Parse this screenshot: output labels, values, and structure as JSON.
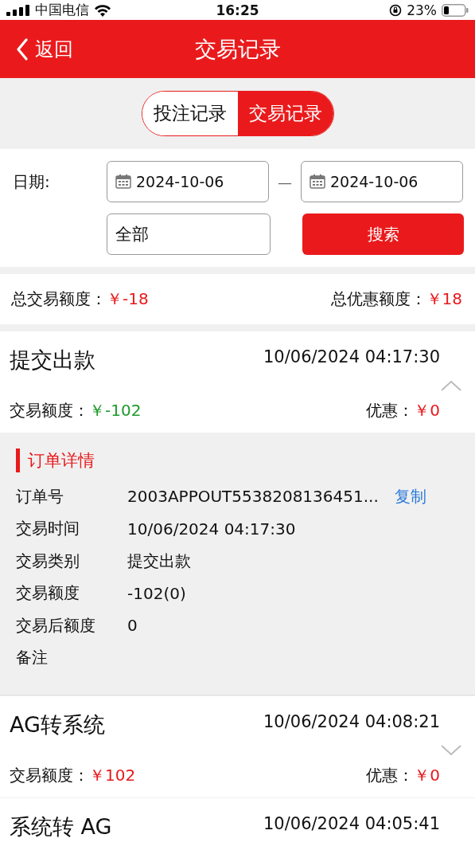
{
  "status_bar": {
    "carrier": "中国电信",
    "time": "16:25",
    "battery": "23%"
  },
  "header": {
    "back": "返回",
    "title": "交易记录"
  },
  "tabs": [
    {
      "label": "投注记录",
      "selected": false
    },
    {
      "label": "交易记录",
      "selected": true
    }
  ],
  "filter": {
    "date_label": "日期:",
    "start_date": "2024-10-06",
    "separator": "—",
    "end_date": "2024-10-06",
    "type": "全部",
    "search_button": "搜索"
  },
  "totals": {
    "transaction_label": "总交易额度：",
    "transaction_value": "￥-18",
    "bonus_label": "总优惠额度：",
    "bonus_value": "￥18"
  },
  "records": [
    {
      "title": "提交出款",
      "time": "10/06/2024 04:17:30",
      "amount_label": "交易额度：",
      "amount": "￥-102",
      "color": "#1e9a2a",
      "bonus_label": "优惠：",
      "bonus": "￥0",
      "expanded": true,
      "details": {
        "heading": "订单详情",
        "rows": [
          {
            "label": "订单号",
            "value": "2003APPOUT5538208136451...",
            "action": "复制"
          },
          {
            "label": "交易时间",
            "value": "10/06/2024 04:17:30"
          },
          {
            "label": "交易类别",
            "value": "提交出款"
          },
          {
            "label": "交易额度",
            "value": "-102(0)"
          },
          {
            "label": "交易后额度",
            "value": "0"
          },
          {
            "label": "备注"
          }
        ]
      }
    },
    {
      "title": "AG转系统",
      "time": "10/06/2024 04:08:21",
      "amount_label": "交易额度：",
      "amount": "￥102",
      "color": "#e8191c",
      "bonus_label": "优惠：",
      "bonus": "￥0",
      "expanded": false
    },
    {
      "title": "系统转 AG",
      "time": "10/06/2024 04:05:41"
    }
  ]
}
